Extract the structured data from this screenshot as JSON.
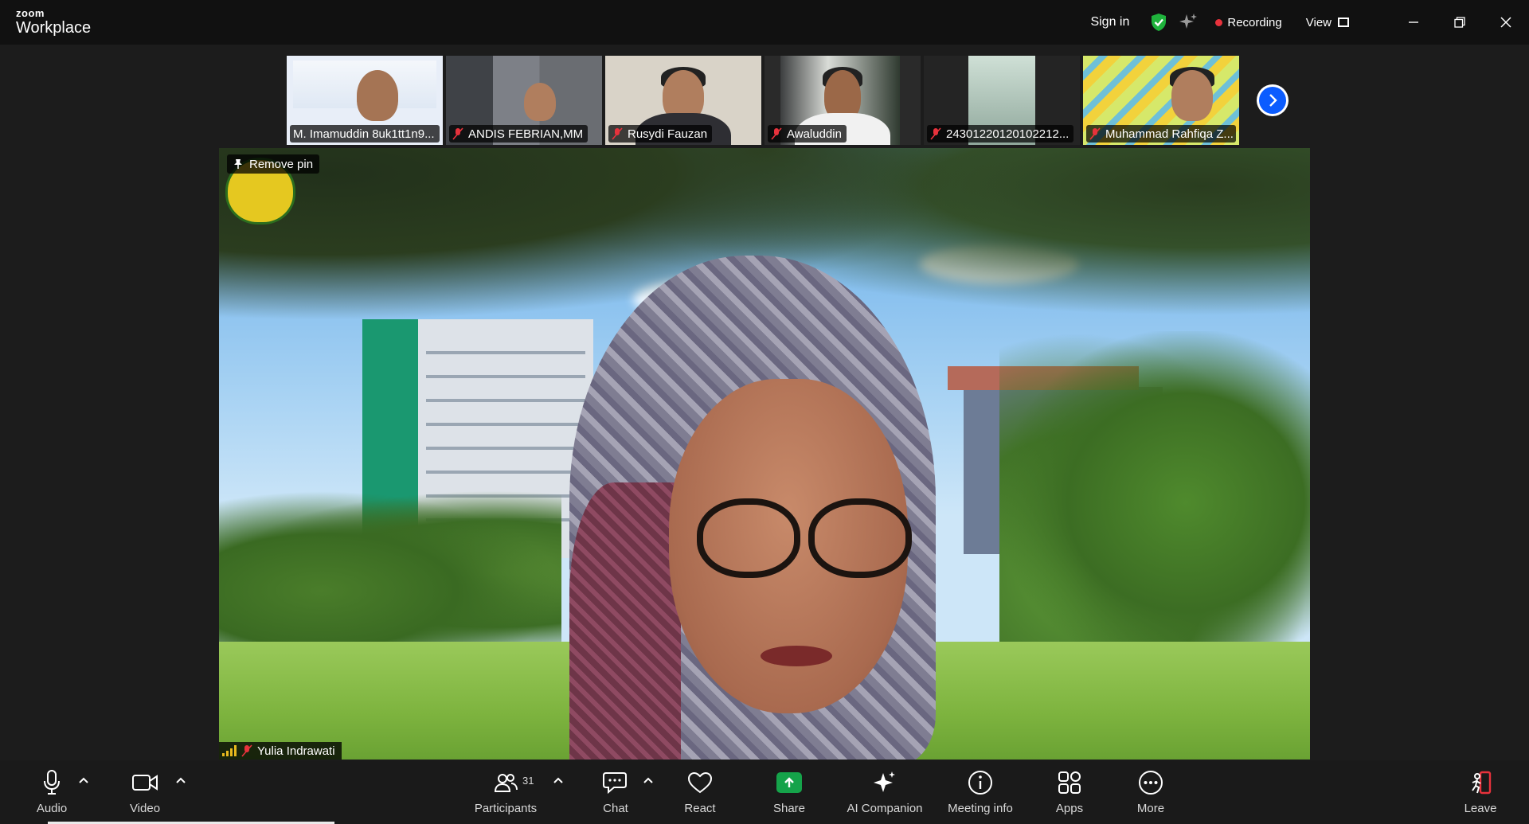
{
  "titlebar": {
    "brand_small": "zoom",
    "brand_large": "Workplace",
    "sign_in": "Sign in",
    "recording": "Recording",
    "view": "View"
  },
  "gallery": [
    {
      "name": "M. Imamuddin 8uk1tt1n9...",
      "bg": "#e8eef8"
    },
    {
      "name": "ANDIS FEBRIAN,MM",
      "bg": "#5c6066"
    },
    {
      "name": "Rusydi Fauzan",
      "bg": "#d9d3c8"
    },
    {
      "name": "Awaluddin",
      "bg": "#2a2a2a"
    },
    {
      "name": "24301220120102212...",
      "bg": "#242424"
    },
    {
      "name": "Muhammad Rahfiqa Z...",
      "bg": "#b9d86a"
    }
  ],
  "main": {
    "pin_label": "Remove pin",
    "speaker_name": "Yulia Indrawati"
  },
  "toolbar": {
    "audio": "Audio",
    "video": "Video",
    "participants": "Participants",
    "participant_count": "31",
    "chat": "Chat",
    "react": "React",
    "share": "Share",
    "ai_companion": "AI Companion",
    "meeting_info": "Meeting info",
    "apps": "Apps",
    "more": "More",
    "leave": "Leave"
  },
  "colors": {
    "accent_blue": "#0b5cff",
    "share_green": "#15a34a",
    "mute_red": "#e8323c",
    "shield_green": "#1fb33c"
  }
}
